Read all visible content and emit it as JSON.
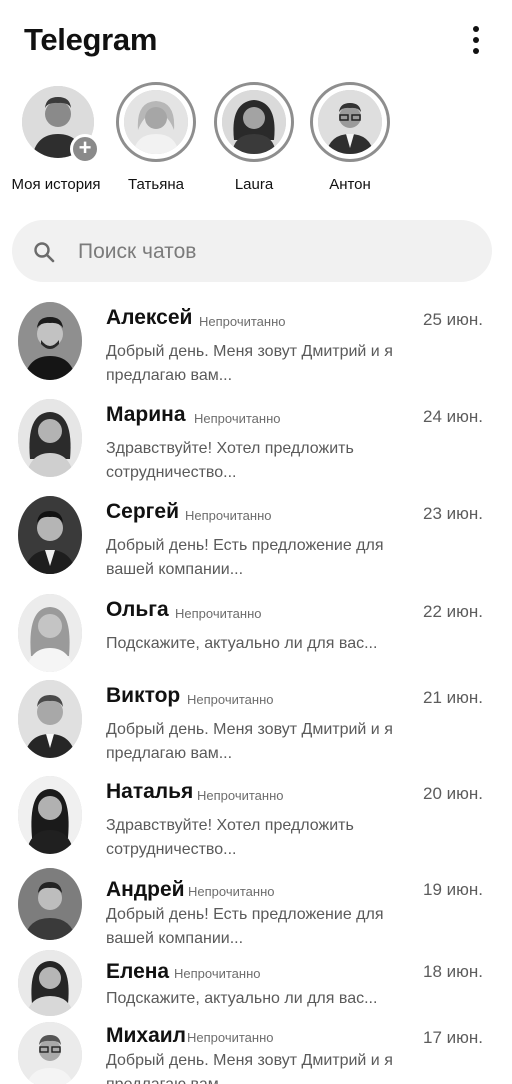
{
  "header": {
    "title": "Telegram",
    "menu_icon": "more-vertical-icon"
  },
  "stories": [
    {
      "name": "Моя история",
      "own": true,
      "add_icon": "plus-icon"
    },
    {
      "name": "Татьяна"
    },
    {
      "name": "Laura"
    },
    {
      "name": "Антон"
    }
  ],
  "search": {
    "placeholder": "Поиск чатов",
    "icon": "search-icon"
  },
  "chats": [
    {
      "name": "Алексей",
      "status": "Непрочитанно",
      "date": "25 июн.",
      "preview": "Добрый день. Меня зовут Дмитрий и я предлагаю вам..."
    },
    {
      "name": "Марина",
      "status": "Непрочитанно",
      "date": "24 июн.",
      "preview": "Здравствуйте! Хотел предложить сотрудничество..."
    },
    {
      "name": "Сергей",
      "status": "Непрочитанно",
      "date": "23 июн.",
      "preview": "Добрый день! Есть предложение для вашей компании..."
    },
    {
      "name": "Ольга",
      "status": "Непрочитанно",
      "date": "22 июн.",
      "preview": "Подскажите, актуально ли для вас..."
    },
    {
      "name": "Виктор",
      "status": "Непрочитанно",
      "date": "21 июн.",
      "preview": "Добрый день. Меня зовут Дмитрий и я предлагаю вам..."
    },
    {
      "name": "Наталья",
      "status": "Непрочитанно",
      "date": "20 июн.",
      "preview": "Здравствуйте! Хотел предложить сотрудничество..."
    },
    {
      "name": "Андрей",
      "status": "Непрочитанно",
      "date": "19 июн.",
      "preview": "Добрый день! Есть предложение для вашей компании..."
    },
    {
      "name": "Елена",
      "status": "Непрочитанно",
      "date": "18 июн.",
      "preview": "Подскажите, актуально ли для вас..."
    },
    {
      "name": "Михаил",
      "status": "Непрочитанно",
      "date": "17 июн.",
      "preview": "Добрый день. Меня зовут Дмитрий и я предлагаю вам..."
    }
  ]
}
